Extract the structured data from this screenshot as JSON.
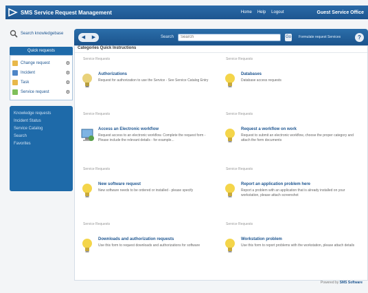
{
  "app": {
    "title": "SMS Service Request Management",
    "links": [
      "Home",
      "Help",
      "Logout"
    ],
    "user": "Guest Service Office"
  },
  "sidebar": {
    "search_link": "Search knowledgebase",
    "quick_title": "Quick requests",
    "quick_items": [
      {
        "label": "Change request",
        "color": "#e8b84a"
      },
      {
        "label": "Incident",
        "color": "#4f86c6"
      },
      {
        "label": "Task",
        "color": "#e8b84a"
      },
      {
        "label": "Service request",
        "color": "#7fbf5a"
      }
    ],
    "nav_items": [
      "Knowledge requests",
      "Incident Status",
      "Service Catalog",
      "Search",
      "Favorites"
    ]
  },
  "toolbar": {
    "back": "◀",
    "forward": "▶",
    "search_label": "Search",
    "search_value": "",
    "search_placeholder": "Search",
    "go": "Go",
    "advanced": "Formulate request Services",
    "help": "?"
  },
  "content": {
    "heading": "Categories Quick Instructions",
    "cards": [
      {
        "category": "Service Requests",
        "title": "Authorizations",
        "desc": "Request for authorization to use the Service - See Service Catalog Entry",
        "icon": "bulb-gray"
      },
      {
        "category": "Service Requests",
        "title": "Databases",
        "desc": "Database access requests",
        "icon": "bulb"
      },
      {
        "category": "Service Requests",
        "title": "Access an Electronic workflow",
        "desc": "Request access to an electronic workflow. Complete the request form - Please include the relevant details - for example...",
        "icon": "computer"
      },
      {
        "category": "Service Requests",
        "title": "Request a workflow on work",
        "desc": "Request to submit an electronic workflow, choose the proper category and attach the form documents",
        "icon": "bulb"
      },
      {
        "category": "Service Requests",
        "title": "New software request",
        "desc": "New software needs to be ordered or installed - please specify",
        "icon": "bulb"
      },
      {
        "category": "Service Requests",
        "title": "Report an application problem here",
        "desc": "Report a problem with an application that is already installed on your workstation, please attach screenshot",
        "icon": "bulb"
      },
      {
        "category": "Service Requests",
        "title": "Downloads and authorization requests",
        "desc": "Use this form to request downloads and authorizations for software",
        "icon": "bulb"
      },
      {
        "category": "Service Requests",
        "title": "Workstation problem",
        "desc": "Use this form to report problems with the workstation, please attach details",
        "icon": "bulb"
      }
    ]
  },
  "footer": {
    "prefix": "Powered by",
    "brand": "SMS Software"
  }
}
